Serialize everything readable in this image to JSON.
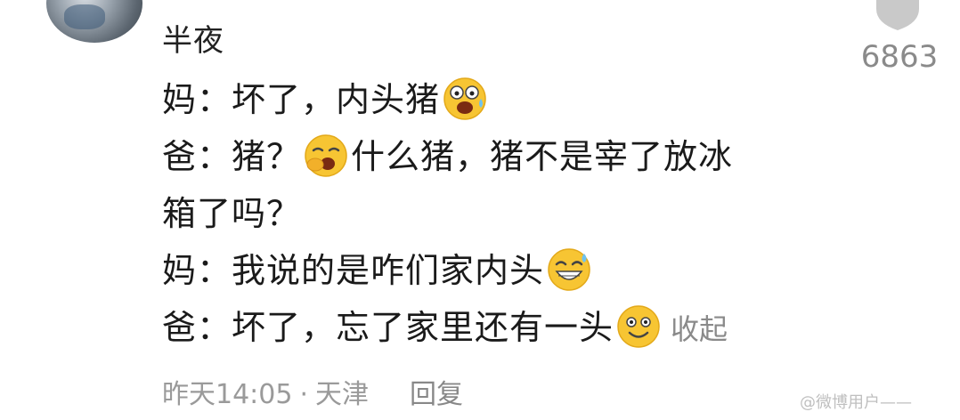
{
  "comment": {
    "username": "半夜",
    "likes": "6863",
    "lines": {
      "l1": {
        "a": "妈：坏了，内头猪"
      },
      "l2": {
        "a": "爸：猪？",
        "b": "什么猪，猪不是宰了放冰"
      },
      "l3": {
        "a": "箱了吗？"
      },
      "l4": {
        "a": "妈：我说的是咋们家内头"
      },
      "l5": {
        "a": "爸：坏了，忘了家里还有一头",
        "collapse": "收起"
      }
    },
    "emojis": {
      "l1": "shocked-sweat-face-icon",
      "l2": "sleepy-yawn-face-icon",
      "l4": "grinning-sweat-face-icon",
      "l5": "smiling-face-icon"
    },
    "meta": {
      "time": "昨天14:05",
      "separator": "·",
      "location": "天津",
      "reply": "回复"
    },
    "watermark": "@微博用户——"
  },
  "colors": {
    "text": "#1a1a1a",
    "secondary": "#8a8a8a",
    "emoji_yellow": "#f7c533"
  }
}
